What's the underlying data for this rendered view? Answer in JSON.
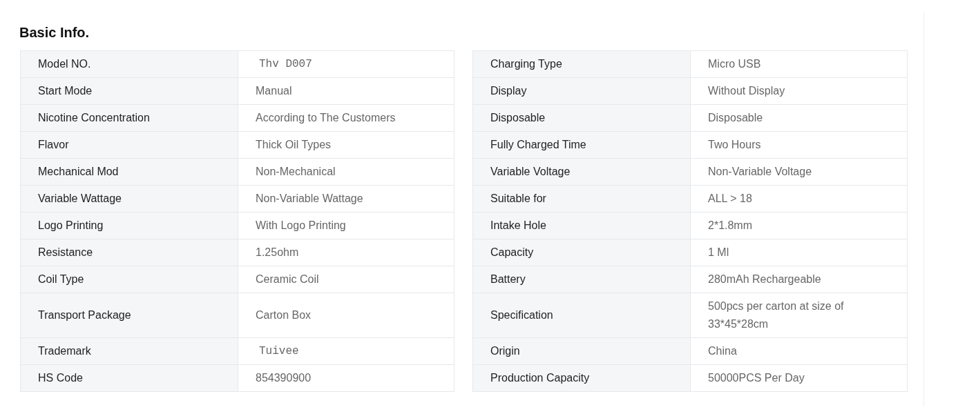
{
  "title": "Basic Info.",
  "left_table": [
    {
      "label": "Model NO.",
      "value": "Thv D007",
      "kind": "typed"
    },
    {
      "label": "Start Mode",
      "value": "Manual",
      "kind": "plain"
    },
    {
      "label": "Nicotine Concentration",
      "value": "According to The Customers",
      "kind": "plain"
    },
    {
      "label": "Flavor",
      "value": "Thick Oil Types",
      "kind": "plain"
    },
    {
      "label": "Mechanical Mod",
      "value": "Non-Mechanical",
      "kind": "plain"
    },
    {
      "label": "Variable Wattage",
      "value": "Non-Variable Wattage",
      "kind": "plain"
    },
    {
      "label": "Logo Printing",
      "value": "With Logo Printing",
      "kind": "plain"
    },
    {
      "label": "Resistance",
      "value": "1.25ohm",
      "kind": "plain"
    },
    {
      "label": "Coil Type",
      "value": "Ceramic Coil",
      "kind": "plain"
    },
    {
      "label": "Transport Package",
      "value": "Carton Box",
      "kind": "plain"
    },
    {
      "label": "Trademark",
      "value": "Tuivee",
      "kind": "typed"
    },
    {
      "label": "HS Code",
      "value": "854390900",
      "kind": "plain"
    }
  ],
  "right_table": [
    {
      "label": "Charging Type",
      "value": "Micro USB",
      "kind": "plain"
    },
    {
      "label": "Display",
      "value": "Without Display",
      "kind": "plain"
    },
    {
      "label": "Disposable",
      "value": "Disposable",
      "kind": "plain"
    },
    {
      "label": "Fully Charged Time",
      "value": "Two Hours",
      "kind": "plain"
    },
    {
      "label": "Variable Voltage",
      "value": "Non-Variable Voltage",
      "kind": "plain"
    },
    {
      "label": "Suitable for",
      "value": "ALL > 18",
      "kind": "plain"
    },
    {
      "label": "Intake Hole",
      "value": "2*1.8mm",
      "kind": "plain"
    },
    {
      "label": "Capacity",
      "value": "1 Ml",
      "kind": "plain"
    },
    {
      "label": "Battery",
      "value": "280mAh Rechargeable",
      "kind": "plain"
    },
    {
      "label": "Specification",
      "value": "500pcs per carton at size of 33*45*28cm",
      "kind": "plain"
    },
    {
      "label": "Origin",
      "value": "China",
      "kind": "plain"
    },
    {
      "label": "Production Capacity",
      "value": "50000PCS Per Day",
      "kind": "plain"
    }
  ]
}
